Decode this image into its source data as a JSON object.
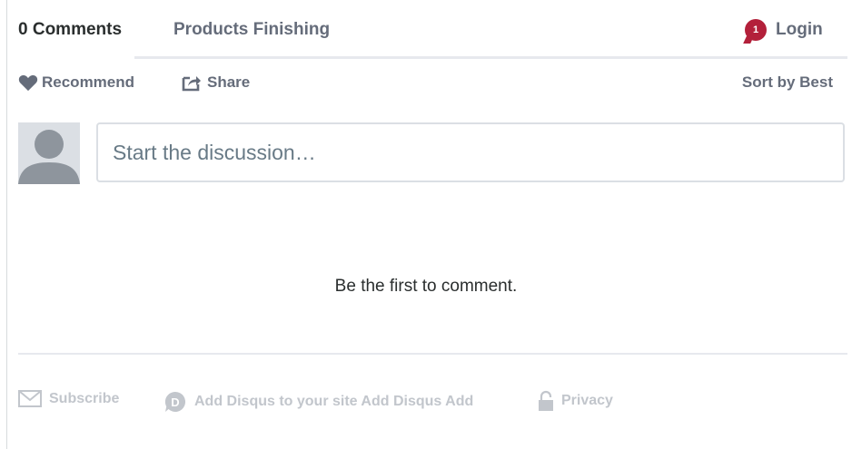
{
  "nav": {
    "comment_count": "0 Comments",
    "forum_name": "Products Finishing",
    "notification_count": "1",
    "login_label": "Login"
  },
  "actions": {
    "recommend_label": "Recommend",
    "share_label": "Share",
    "sort_label": "Sort by Best"
  },
  "composer": {
    "placeholder": "Start the discussion…"
  },
  "empty_state": "Be the first to comment.",
  "footer": {
    "subscribe_label": "Subscribe",
    "disqus_label": "Add Disqus to your site Add Disqus Add",
    "privacy_label": "Privacy"
  },
  "icons": [
    "heart-icon",
    "share-icon",
    "avatar-placeholder",
    "envelope-icon",
    "disqus-logo-icon",
    "lock-icon"
  ],
  "colors": {
    "text_dark": "#2a2e2e",
    "text_muted": "#656c7a",
    "footer_muted": "#c2c6cc",
    "notification_red": "#b3203a",
    "border": "#dbdfe4"
  }
}
